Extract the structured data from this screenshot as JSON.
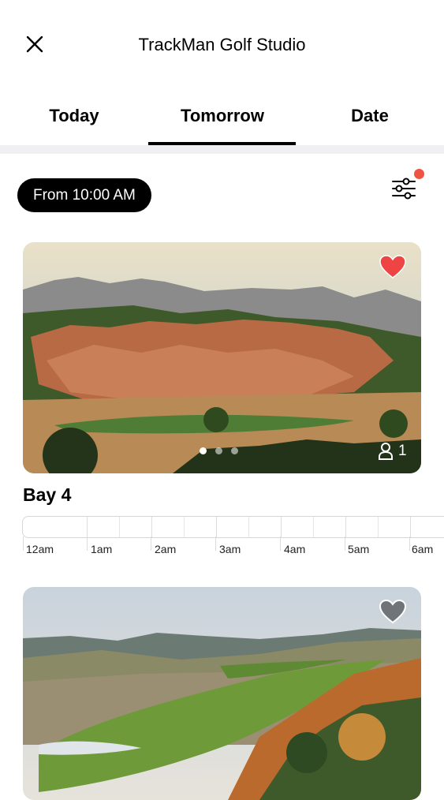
{
  "header": {
    "title": "TrackMan Golf Studio",
    "close_icon": "close-icon"
  },
  "tabs": [
    {
      "label": "Today",
      "active": false
    },
    {
      "label": "Tomorrow",
      "active": true
    },
    {
      "label": "Date",
      "active": false
    }
  ],
  "filter": {
    "time_label": "From 10:00 AM",
    "icon": "sliders-icon",
    "badge_color": "#ef5443"
  },
  "bays": [
    {
      "name": "Bay 4",
      "favorite": true,
      "players": "1",
      "carousel": {
        "total": 3,
        "active": 0
      },
      "timeline_hours": [
        "12am",
        "1am",
        "2am",
        "3am",
        "4am",
        "5am",
        "6am"
      ]
    },
    {
      "favorite": false
    }
  ],
  "colors": {
    "accent": "#000000",
    "favorite": "#ef4444",
    "tab_divider": "#f0f0f2"
  }
}
